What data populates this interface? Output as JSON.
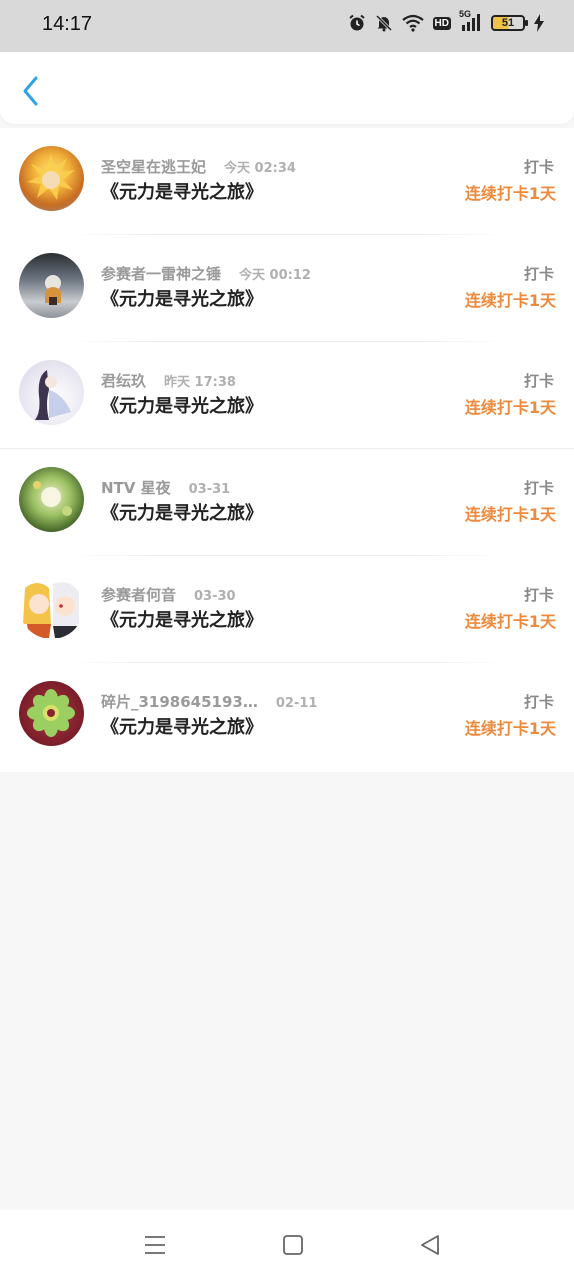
{
  "status_bar": {
    "time": "14:17",
    "icons": [
      "alarm-icon",
      "bell-mute-icon",
      "wifi-icon",
      "hd-icon",
      "5g-signal-icon",
      "battery-icon",
      "charging-icon"
    ],
    "hd_label": "HD",
    "network_label": "5G",
    "battery_level": "51"
  },
  "header": {
    "back_icon": "chevron-left-icon"
  },
  "entries": [
    {
      "name": "圣空星在逃王妃",
      "time": "今天 02:34",
      "title": "《元力是寻光之旅》",
      "tag": "打卡",
      "streak": "连续打卡1天",
      "avatar_colors": [
        "#f2b23a",
        "#a8541e"
      ]
    },
    {
      "name": "参赛者一雷神之锤",
      "time": "今天 00:12",
      "title": "《元力是寻光之旅》",
      "tag": "打卡",
      "streak": "连续打卡1天",
      "avatar_colors": [
        "#5b6670",
        "#c9ccd0"
      ]
    },
    {
      "name": "君纭玖",
      "time": "昨天 17:38",
      "title": "《元力是寻光之旅》",
      "tag": "打卡",
      "streak": "连续打卡1天",
      "avatar_colors": [
        "#e8e2f2",
        "#6a5a8c"
      ]
    },
    {
      "name": "NTV 星夜",
      "time": "03-31",
      "title": "《元力是寻光之旅》",
      "tag": "打卡",
      "streak": "连续打卡1天",
      "avatar_colors": [
        "#8fb25a",
        "#2f4a22"
      ]
    },
    {
      "name": "参赛者何音",
      "time": "03-30",
      "title": "《元力是寻光之旅》",
      "tag": "打卡",
      "streak": "连续打卡1天",
      "avatar_colors": [
        "#f4d27a",
        "#e7e7ee"
      ]
    },
    {
      "name": "碎片_3198645193…",
      "time": "02-11",
      "title": "《元力是寻光之旅》",
      "tag": "打卡",
      "streak": "连续打卡1天",
      "avatar_colors": [
        "#8a2232",
        "#9bcf62"
      ]
    }
  ],
  "nav_bar": {
    "icons": [
      "menu-icon",
      "home-icon",
      "back-icon"
    ]
  },
  "colors": {
    "accent": "#ef8a3c",
    "back_arrow": "#2fa3e6"
  }
}
